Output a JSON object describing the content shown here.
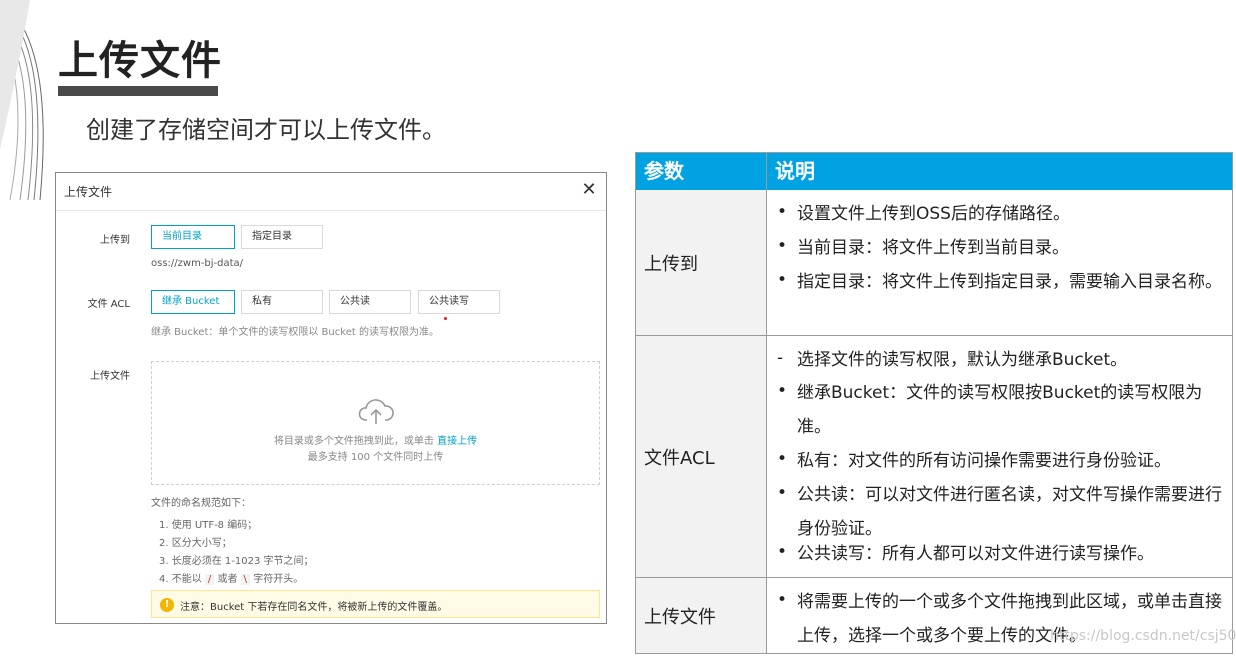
{
  "slide": {
    "title": "上传文件",
    "subtitle": "创建了存储空间才可以上传文件。"
  },
  "dialog": {
    "title": "上传文件",
    "close_icon": "close-icon",
    "upload_to_label": "上传到",
    "dest_options": [
      "当前目录",
      "指定目录"
    ],
    "dest_selected": "当前目录",
    "path": "oss://zwm-bj-data/",
    "acl_label": "文件 ACL",
    "acl_options": [
      "继承 Bucket",
      "私有",
      "公共读",
      "公共读写"
    ],
    "acl_selected": "继承 Bucket",
    "acl_hint": "继承 Bucket：单个文件的读写权限以 Bucket 的读写权限为准。",
    "file_label": "上传文件",
    "drop_text": "将目录或多个文件拖拽到此，或单击",
    "drop_link": "直接上传",
    "drop_limit": "最多支持 100 个文件同时上传",
    "rules_title": "文件的命名规范如下：",
    "rules": [
      "1. 使用 UTF-8 编码；",
      "2. 区分大小写；",
      "3. 长度必须在 1-1023 字节之间；"
    ],
    "rule4_prefix": "4. 不能以",
    "rule4_code1": "/",
    "rule4_mid": "或者",
    "rule4_code2": "\\",
    "rule4_suffix": "字符开头。",
    "warning": "注意：Bucket 下若存在同名文件，将被新上传的文件覆盖。",
    "accent_color": "#00a2ca"
  },
  "table": {
    "headers": [
      "参数",
      "说明"
    ],
    "header_color": "#00a2e2",
    "rows": [
      {
        "name": "上传到",
        "items": [
          {
            "mark": "•",
            "text": "设置文件上传到OSS后的存储路径。"
          },
          {
            "mark": "•",
            "text": "当前目录：将文件上传到当前目录。"
          },
          {
            "mark": "•",
            "text": "指定目录：将文件上传到指定目录，需要输入目录名称。"
          }
        ]
      },
      {
        "name": "文件ACL",
        "items": [
          {
            "mark": "-",
            "text": "选择文件的读写权限，默认为继承Bucket。"
          },
          {
            "mark": "•",
            "text": "继承Bucket：文件的读写权限按Bucket的读写权限为准。"
          },
          {
            "mark": "•",
            "text": "私有：对文件的所有访问操作需要进行身份验证。"
          },
          {
            "mark": "•",
            "text": "公共读：可以对文件进行匿名读，对文件写操作需要进行身份验证。"
          },
          {
            "mark": "•",
            "text": "公共读写：所有人都可以对文件进行读写操作。"
          }
        ]
      },
      {
        "name": "上传文件",
        "items": [
          {
            "mark": "•",
            "text": "将需要上传的一个或多个文件拖拽到此区域，或单击直接上传，选择一个或多个要上传的文件。"
          }
        ]
      }
    ]
  },
  "watermark": "https://blog.csdn.net/csj50"
}
